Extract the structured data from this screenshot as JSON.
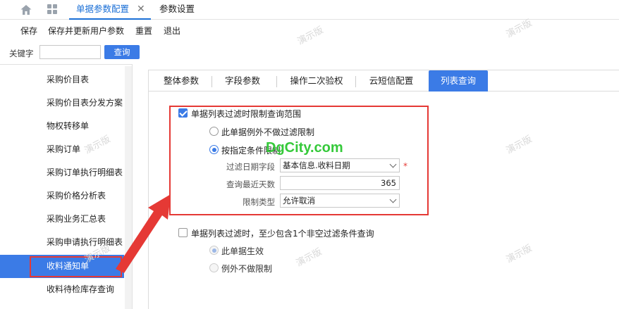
{
  "tabs": {
    "active_label": "单据参数配置",
    "close_glyph": "✕",
    "second_label": "参数设置"
  },
  "toolbar": {
    "save": "保存",
    "save_update": "保存并更新用户参数",
    "reset": "重置",
    "exit": "退出"
  },
  "search": {
    "keyword_label": "关键字",
    "keyword_value": "",
    "query_btn": "查询"
  },
  "sidebar": {
    "items": [
      {
        "label": "采购价目表"
      },
      {
        "label": "采购价目表分发方案"
      },
      {
        "label": "物权转移单"
      },
      {
        "label": "采购订单"
      },
      {
        "label": "采购订单执行明细表"
      },
      {
        "label": "采购价格分析表"
      },
      {
        "label": "采购业务汇总表"
      },
      {
        "label": "采购申请执行明细表"
      },
      {
        "label": "收料通知单"
      },
      {
        "label": "收料待检库存查询"
      }
    ],
    "active_index": 8
  },
  "subtabs": [
    {
      "label": "整体参数"
    },
    {
      "label": "字段参数"
    },
    {
      "label": "操作二次验权"
    },
    {
      "label": "云短信配置"
    },
    {
      "label": "列表查询"
    }
  ],
  "settings": {
    "limit_scope": {
      "label": "单据列表过滤时限制查询范围",
      "checked": true
    },
    "opt_exempt": "此单据例外不做过滤限制",
    "opt_by_condition": "按指定条件限制",
    "date_field_label": "过滤日期字段",
    "date_field_value": "基本信息.收料日期",
    "recent_days_label": "查询最近天数",
    "recent_days_value": "365",
    "limit_type_label": "限制类型",
    "limit_type_value": "允许取消",
    "at_least_one": {
      "label": "单据列表过滤时，至少包含1个非空过滤条件查询",
      "checked": false
    },
    "opt_this_effective": "此单据生效",
    "opt_exempt_no_limit": "例外不做限制"
  },
  "watermark_text": "演示版",
  "brand_text": "DgCity.com",
  "colors": {
    "accent": "#3b7be6",
    "highlight_red": "#e53935",
    "brand_green": "#35c93a"
  }
}
